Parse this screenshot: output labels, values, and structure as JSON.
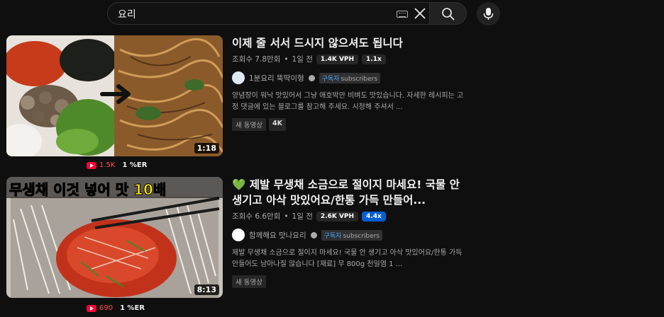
{
  "search": {
    "query": "요리"
  },
  "videos": [
    {
      "title": "이제 줄 서서 드시지 않으셔도 됩니다",
      "title_prefix": "",
      "views": "조회수 7.8만회",
      "age": "1일 전",
      "vph": "1.4K VPH",
      "multiplier": "1.1x",
      "multiplier_highlight": false,
      "channel": "1분요리 뚝딱이형",
      "sub_label_ko": "구독자",
      "sub_label_en": "subscribers",
      "description": "양념장이 워낙 맛있어서 그냥 애호박만 비벼도 맛있습니다. 자세한 레시피는 고정 댓글에 있는 블로그를 참고해 주세요. 시청해 주셔서 ...",
      "tags": [
        "새 동영상",
        "4K"
      ],
      "duration": "1:18",
      "mini_views": "1.5K",
      "er": "1 %ER"
    },
    {
      "title": "제발 무생채 소금으로 절이지 마세요! 국물 안 생기고 아삭 맛있어요/한통 가득 만들어...",
      "title_prefix": "💚",
      "views": "조회수 6.6만회",
      "age": "1일 전",
      "vph": "2.6K VPH",
      "multiplier": "4.4x",
      "multiplier_highlight": true,
      "channel": "함께해요 맛나요리",
      "sub_label_ko": "구독자",
      "sub_label_en": "subscribers",
      "description": "제발 무생채 소금으로 절이지 마세요! 국물 안 생기고 아삭 맛있어요/한통 가득 만들어도 남아나질 않습니다 [재료] 무 800g 천일염 1 ...",
      "tags": [
        "새 동영상"
      ],
      "duration": "8:13",
      "thumb_text": [
        "무생채",
        "이것 넣어",
        "맛 10배"
      ],
      "mini_views": "690",
      "er": "1 %ER"
    }
  ],
  "colors": {
    "bg": "#0f0f0f",
    "accent": "#065fd4",
    "youtube_red": "#ff0033"
  }
}
